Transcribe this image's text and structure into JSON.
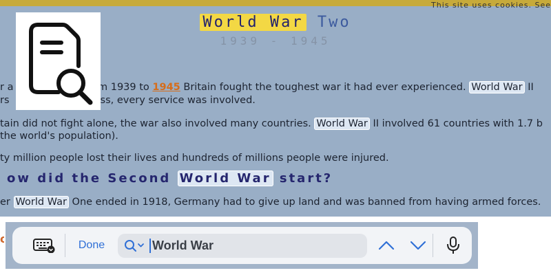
{
  "page": {
    "cookie_notice": "This site uses cookies. See",
    "title_highlight": "World War",
    "title_rest": "Two",
    "subtitle": "1939 - 1945",
    "para1": {
      "line1_a": "r a",
      "line1_b": "rom 1939 to",
      "year": "1945",
      "line1_c": "Britain fought the toughest war it had ever experienced.",
      "match": "World War",
      "line1_d": "II",
      "line2_a": "rs",
      "line2_b": "ss, every service was involved."
    },
    "para2": {
      "line1_a": "tain did not fight alone, the war also involved many countries.",
      "match": "World War",
      "line1_b": "II involved 61 countries with 1.7 b",
      "line2": "the world's population)."
    },
    "para3": "ty million people lost their lives and hundreds of millions people were injured.",
    "heading": {
      "before": "ow did the Second",
      "match": "World War",
      "after": "start?"
    },
    "para4": {
      "before": "er",
      "match": "World War",
      "after": "One ended in 1918, Germany had to give up land and was banned from having armed forces."
    }
  },
  "thumbnail": {
    "icon": "document-search-icon"
  },
  "findbar": {
    "keyboard_icon": "keyboard-dismiss-icon",
    "done_label": "Done",
    "search_icon": "magnifier-dropdown-icon",
    "query": "World War",
    "prev_icon": "chevron-up-icon",
    "next_icon": "chevron-down-icon",
    "mic_icon": "microphone-icon",
    "accent_color": "#2f6fd6"
  },
  "colors": {
    "page_background": "#99aec6",
    "title_highlight": "#f3d844",
    "heading_text": "#25266e",
    "link_year": "#d66d1a"
  }
}
